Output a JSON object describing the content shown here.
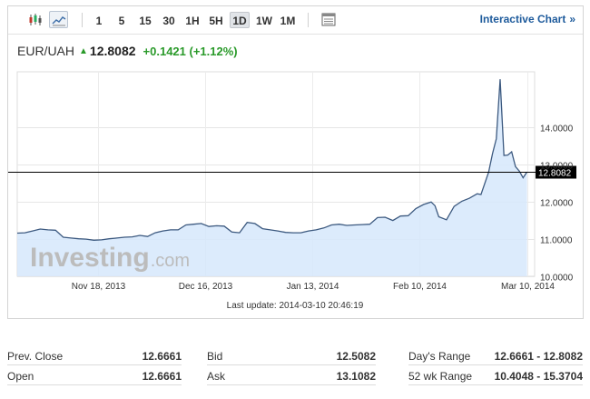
{
  "toolbar": {
    "periods": [
      "1",
      "5",
      "15",
      "30",
      "1H",
      "5H",
      "1D",
      "1W",
      "1M"
    ],
    "active_period": "1D",
    "interactive_label": "Interactive Chart",
    "interactive_chevron": "»"
  },
  "quote": {
    "symbol": "EUR/UAH",
    "price": "12.8082",
    "change": "+0.1421 (+1.12%)",
    "up_color": "#2a9a2a"
  },
  "watermark": {
    "brand": "Investing",
    "suffix": ".com"
  },
  "last_update": "Last update: 2014-03-10 20:46:19",
  "chart_data": {
    "type": "area",
    "ylim": [
      10.0,
      15.5
    ],
    "y_ticks": [
      "10.0000",
      "11.0000",
      "12.0000",
      "13.0000",
      "14.0000"
    ],
    "x_ticks": [
      "Nov 18, 2013",
      "Dec 16, 2013",
      "Jan 13, 2014",
      "Feb 10, 2014",
      "Mar 10, 2014"
    ],
    "x_tick_dates": [
      "2013-11-18",
      "2013-12-16",
      "2014-01-13",
      "2014-02-10",
      "2014-03-10"
    ],
    "xlim": [
      "2013-10-28",
      "2014-03-12"
    ],
    "current_value": 12.8082,
    "current_label": "12.8082",
    "line_color": "#3d5a80",
    "fill_color": "#d6e8fb",
    "grid": true,
    "series": [
      {
        "points": [
          [
            "2013-10-28",
            11.16
          ],
          [
            "2013-10-30",
            11.17
          ],
          [
            "2013-11-01",
            11.22
          ],
          [
            "2013-11-03",
            11.27
          ],
          [
            "2013-11-05",
            11.25
          ],
          [
            "2013-11-07",
            11.24
          ],
          [
            "2013-11-09",
            11.05
          ],
          [
            "2013-11-11",
            11.03
          ],
          [
            "2013-11-13",
            11.01
          ],
          [
            "2013-11-15",
            11.0
          ],
          [
            "2013-11-17",
            10.97
          ],
          [
            "2013-11-19",
            10.98
          ],
          [
            "2013-11-21",
            11.01
          ],
          [
            "2013-11-23",
            11.03
          ],
          [
            "2013-11-25",
            11.05
          ],
          [
            "2013-11-27",
            11.06
          ],
          [
            "2013-11-29",
            11.1
          ],
          [
            "2013-12-01",
            11.07
          ],
          [
            "2013-12-03",
            11.17
          ],
          [
            "2013-12-05",
            11.22
          ],
          [
            "2013-12-07",
            11.25
          ],
          [
            "2013-12-09",
            11.25
          ],
          [
            "2013-12-11",
            11.38
          ],
          [
            "2013-12-13",
            11.4
          ],
          [
            "2013-12-15",
            11.42
          ],
          [
            "2013-12-17",
            11.34
          ],
          [
            "2013-12-19",
            11.36
          ],
          [
            "2013-12-21",
            11.35
          ],
          [
            "2013-12-23",
            11.19
          ],
          [
            "2013-12-25",
            11.17
          ],
          [
            "2013-12-27",
            11.45
          ],
          [
            "2013-12-29",
            11.42
          ],
          [
            "2013-12-31",
            11.28
          ],
          [
            "2014-01-02",
            11.25
          ],
          [
            "2014-01-04",
            11.22
          ],
          [
            "2014-01-06",
            11.18
          ],
          [
            "2014-01-08",
            11.17
          ],
          [
            "2014-01-10",
            11.17
          ],
          [
            "2014-01-12",
            11.22
          ],
          [
            "2014-01-14",
            11.25
          ],
          [
            "2014-01-16",
            11.3
          ],
          [
            "2014-01-18",
            11.38
          ],
          [
            "2014-01-20",
            11.4
          ],
          [
            "2014-01-22",
            11.37
          ],
          [
            "2014-01-24",
            11.38
          ],
          [
            "2014-01-26",
            11.39
          ],
          [
            "2014-01-28",
            11.4
          ],
          [
            "2014-01-30",
            11.58
          ],
          [
            "2014-02-01",
            11.59
          ],
          [
            "2014-02-03",
            11.5
          ],
          [
            "2014-02-05",
            11.62
          ],
          [
            "2014-02-07",
            11.63
          ],
          [
            "2014-02-09",
            11.82
          ],
          [
            "2014-02-11",
            11.93
          ],
          [
            "2014-02-13",
            12.0
          ],
          [
            "2014-02-14",
            11.9
          ],
          [
            "2014-02-15",
            11.6
          ],
          [
            "2014-02-17",
            11.52
          ],
          [
            "2014-02-19",
            11.88
          ],
          [
            "2014-02-21",
            12.02
          ],
          [
            "2014-02-23",
            12.1
          ],
          [
            "2014-02-25",
            12.22
          ],
          [
            "2014-02-26",
            12.2
          ],
          [
            "2014-02-28",
            12.8
          ],
          [
            "2014-03-01",
            13.3
          ],
          [
            "2014-03-02",
            13.7
          ],
          [
            "2014-03-03",
            15.3
          ],
          [
            "2014-03-04",
            13.25
          ],
          [
            "2014-03-05",
            13.26
          ],
          [
            "2014-03-06",
            13.35
          ],
          [
            "2014-03-07",
            12.95
          ],
          [
            "2014-03-08",
            12.83
          ],
          [
            "2014-03-09",
            12.65
          ],
          [
            "2014-03-10",
            12.8082
          ]
        ]
      }
    ]
  },
  "stats": [
    [
      {
        "label": "Prev. Close",
        "value": "12.6661"
      },
      {
        "label": "Bid",
        "value": "12.5082"
      },
      {
        "label": "Day's Range",
        "value": "12.6661 - 12.8082"
      }
    ],
    [
      {
        "label": "Open",
        "value": "12.6661"
      },
      {
        "label": "Ask",
        "value": "13.1082"
      },
      {
        "label": "52 wk Range",
        "value": "10.4048 - 15.3704"
      }
    ]
  ]
}
